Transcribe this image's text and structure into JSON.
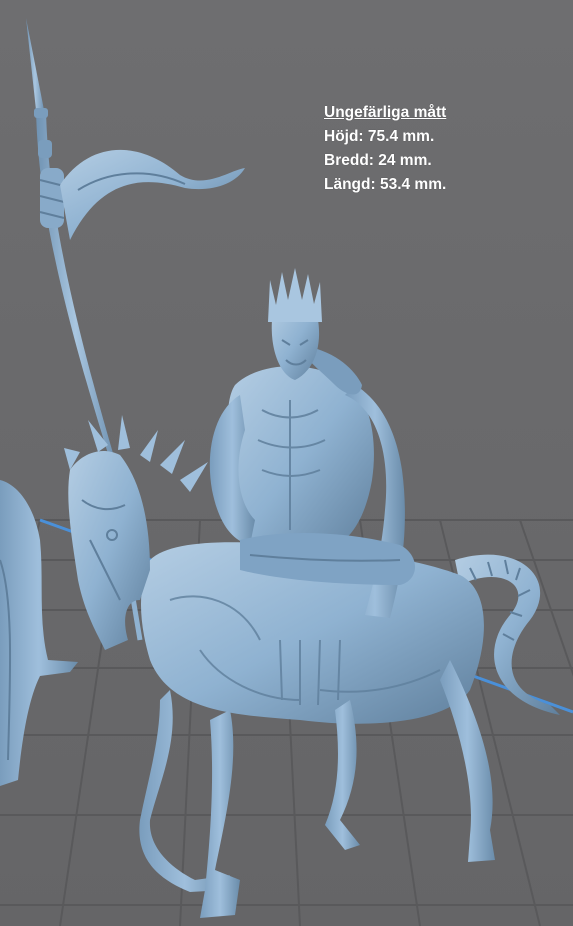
{
  "dimensions": {
    "heading": "Ungefärliga mått",
    "height": "Höjd: 75.4 mm.",
    "width": "Bredd: 24 mm.",
    "length": "Längd: 53.4 mm."
  },
  "colors": {
    "background": "#6b6b6d",
    "grid": "#5a5a5c",
    "model": "#8fb2d1",
    "model_shadow": "#5f7f9c",
    "model_highlight": "#bcd4ea",
    "axis": "#4a90d9",
    "text": "#ffffff"
  }
}
